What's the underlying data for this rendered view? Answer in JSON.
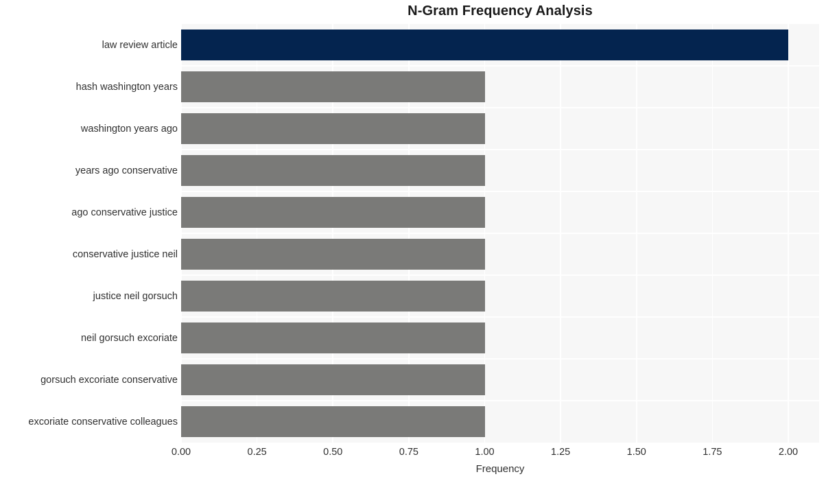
{
  "chart_data": {
    "type": "bar",
    "orientation": "horizontal",
    "title": "N-Gram Frequency Analysis",
    "xlabel": "Frequency",
    "ylabel": "",
    "xlim": [
      0,
      2
    ],
    "ylim": [
      0,
      10
    ],
    "grid": true,
    "legend": null,
    "categories": [
      "law review article",
      "hash washington years",
      "washington years ago",
      "years ago conservative",
      "ago conservative justice",
      "conservative justice neil",
      "justice neil gorsuch",
      "neil gorsuch excoriate",
      "gorsuch excoriate conservative",
      "excoriate conservative colleagues"
    ],
    "values": [
      2,
      1,
      1,
      1,
      1,
      1,
      1,
      1,
      1,
      1
    ],
    "bar_colors": [
      "#04244f",
      "#7a7a78",
      "#7a7a78",
      "#7a7a78",
      "#7a7a78",
      "#7a7a78",
      "#7a7a78",
      "#7a7a78",
      "#7a7a78",
      "#7a7a78"
    ],
    "xticks": [
      0,
      0.25,
      0.5,
      0.75,
      1,
      1.25,
      1.5,
      1.75,
      2
    ],
    "xtick_labels": [
      "0.00",
      "0.25",
      "0.50",
      "0.75",
      "1.00",
      "1.25",
      "1.50",
      "1.75",
      "2.00"
    ],
    "plot_background": "#f7f7f7",
    "figure_background": "#ffffff",
    "gridline_color": "#ffffff",
    "text_color": "#303030",
    "title_color": "#1a1a1a"
  }
}
